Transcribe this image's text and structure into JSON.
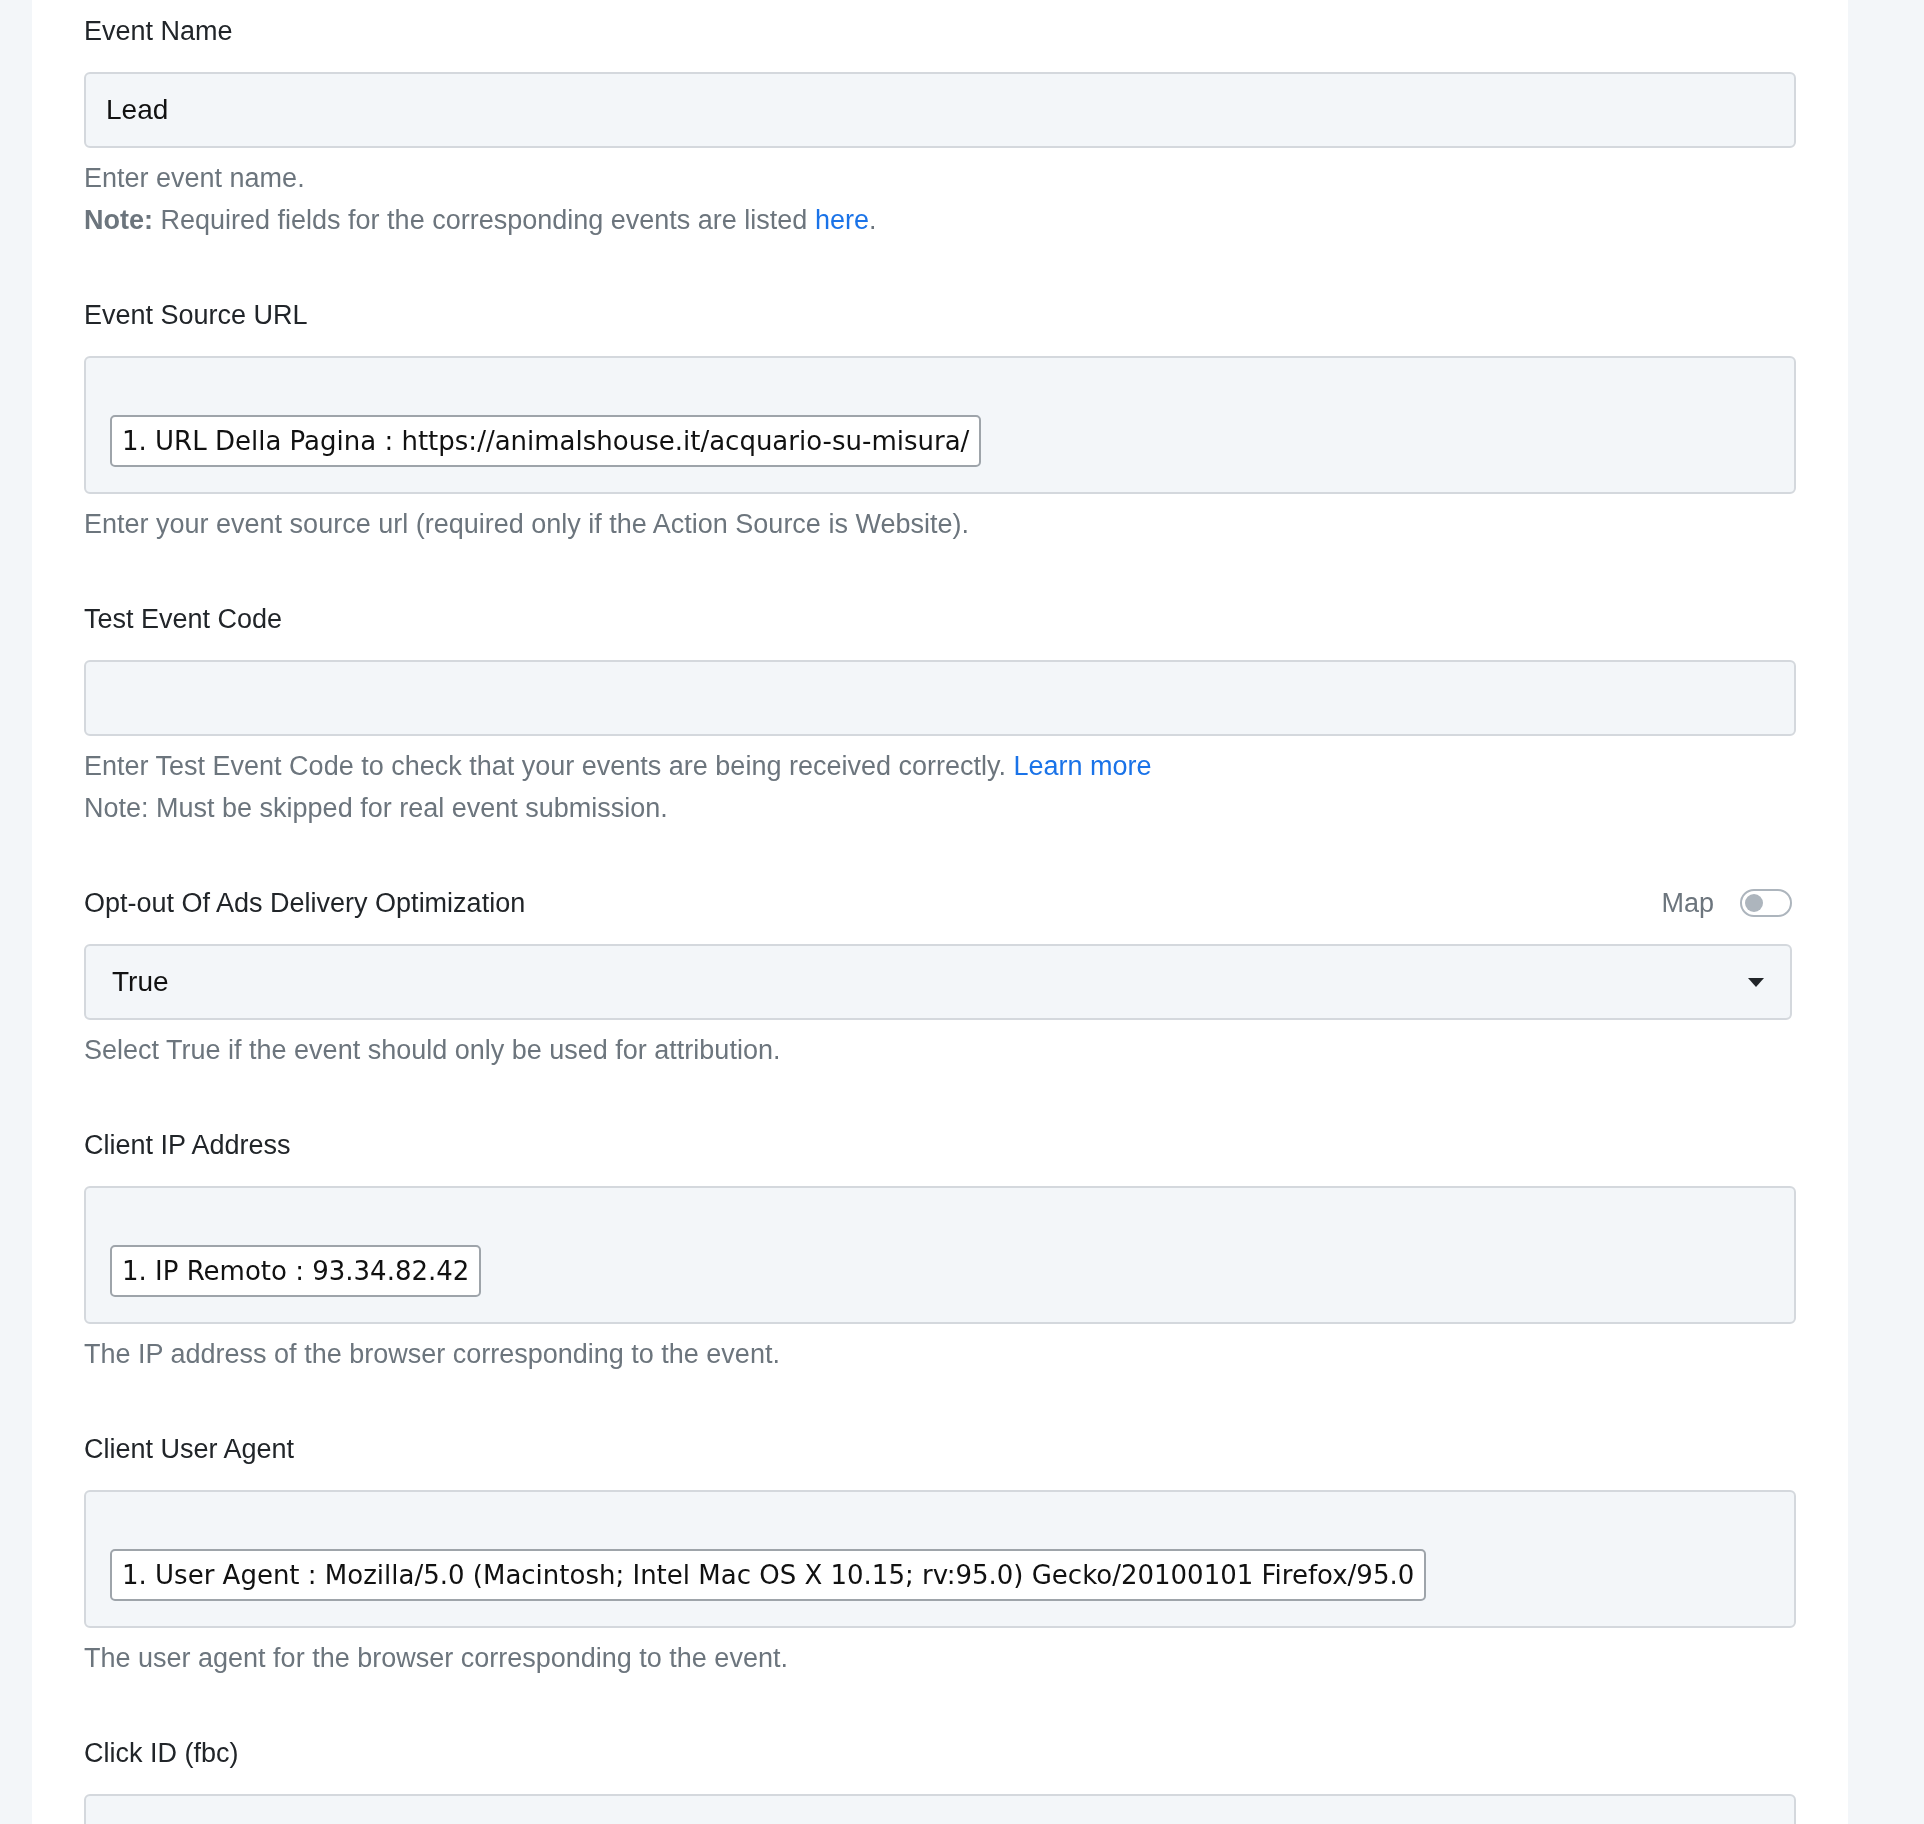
{
  "fields": [
    {
      "kind": "text",
      "label": "Event Name",
      "value": "Lead",
      "help": [
        {
          "text": "Enter event name."
        },
        {
          "text": "**Note:** Required fields for the corresponding events are listed ",
          "link": "here",
          "after": "."
        }
      ]
    },
    {
      "kind": "tokens",
      "label": "Event Source URL",
      "tokens": [
        "1. URL Della Pagina : https://animalshouse.it/acquario-su-misura/"
      ],
      "help": [
        {
          "text": "Enter your event source url (required only if the Action Source is Website)."
        }
      ]
    },
    {
      "kind": "text",
      "label": "Test Event Code",
      "help": [
        {
          "text": "Enter Test Event Code to check that your events are being received correctly. ",
          "link": "Learn more"
        },
        {
          "text": "Note: Must be skipped for real event submission."
        }
      ]
    },
    {
      "kind": "select",
      "label": "Opt-out Of Ads Delivery Optimization",
      "toggle": {
        "label": "Map",
        "on": false
      },
      "value": "True",
      "help": [
        {
          "text": "Select True if the event should only be used for attribution."
        }
      ]
    },
    {
      "kind": "tokens",
      "label": "Client IP Address",
      "tokens": [
        "1. IP Remoto : 93.34.82.42"
      ],
      "help": [
        {
          "text": "The IP address of the browser corresponding to the event."
        }
      ]
    },
    {
      "kind": "tokens",
      "label": "Client User Agent",
      "tokens": [
        "1. User Agent : Mozilla/5.0 (Macintosh; Intel Mac OS X 10.15; rv:95.0) Gecko/20100101 Firefox/95.0"
      ],
      "help": [
        {
          "text": "The user agent for the browser corresponding to the event."
        }
      ]
    },
    {
      "kind": "text",
      "label": "Click ID (fbc)"
    }
  ]
}
